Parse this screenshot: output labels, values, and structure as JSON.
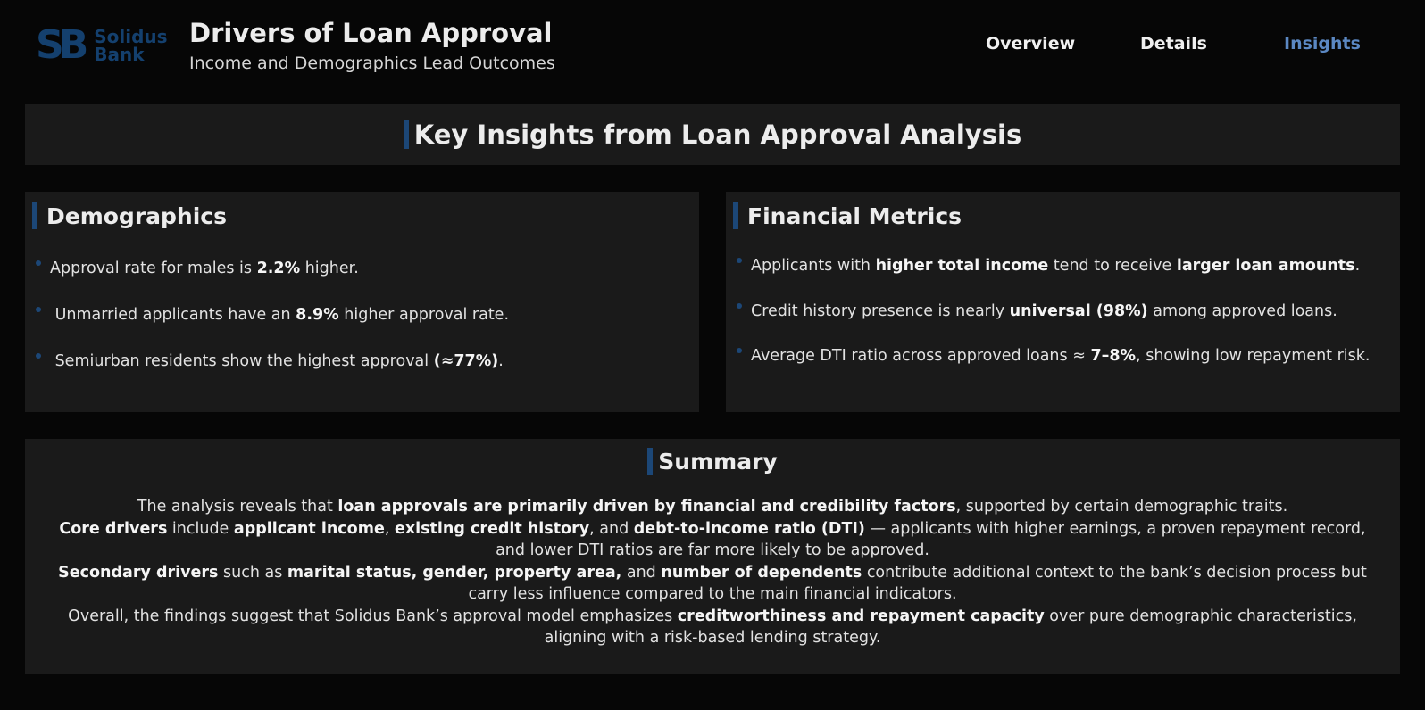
{
  "header": {
    "logo_mark": "SB",
    "logo_line1": "Solidus",
    "logo_line2": "Bank",
    "title": "Drivers of Loan Approval",
    "subtitle": "Income and Demographics Lead Outcomes"
  },
  "nav": {
    "items": [
      {
        "label": "Overview",
        "active": false
      },
      {
        "label": "Details",
        "active": false
      },
      {
        "label": "Insights",
        "active": true
      }
    ]
  },
  "banner": {
    "title": "Key Insights from Loan Approval Analysis"
  },
  "demographics": {
    "title": "Demographics",
    "bullets": [
      {
        "pre": "Approval rate for males is ",
        "bold": "2.2%",
        "post": " higher."
      },
      {
        "pre": "Unmarried applicants have an ",
        "bold": "8.9%",
        "post": " higher approval rate."
      },
      {
        "pre": "Semiurban residents show the highest approval ",
        "bold": "(≈77%)",
        "post": "."
      }
    ]
  },
  "financial": {
    "title": "Financial Metrics",
    "bullets": [
      {
        "pre": "Applicants with ",
        "bold": "higher total income",
        "mid": " tend to receive ",
        "bold2": "larger loan amounts",
        "post": "."
      },
      {
        "pre": "Credit history presence is nearly ",
        "bold": "universal (98%)",
        "post": " among approved loans."
      },
      {
        "pre": "Average DTI ratio across approved loans ≈ ",
        "bold": "7–8%",
        "post": ", showing low repayment risk."
      }
    ]
  },
  "summary": {
    "title": "Summary",
    "p1": {
      "a": "The analysis reveals that ",
      "b": "loan approvals are primarily driven by financial and credibility factors",
      "c": ", supported by certain demographic traits."
    },
    "p2": {
      "a": "Core drivers",
      "b": " include ",
      "c": "applicant income",
      "d": ", ",
      "e": "existing credit history",
      "f": ", and ",
      "g": "debt-to-income ratio (DTI)",
      "h": " — applicants with higher earnings, a proven repayment record, and lower DTI ratios are far more likely to be approved."
    },
    "p3": {
      "a": "Secondary drivers",
      "b": " such as ",
      "c": "marital status, gender, property area,",
      "d": " and ",
      "e": "number of dependents",
      "f": " contribute additional context to the bank’s decision process but carry less influence compared to the main financial indicators."
    },
    "p4": {
      "a": "Overall, the findings suggest that Solidus Bank’s approval model emphasizes ",
      "b": "creditworthiness and repayment capacity",
      "c": " over pure demographic characteristics, aligning with a risk-based lending strategy."
    }
  },
  "colors": {
    "accent": "#1c4777",
    "nav_active": "#5b88c3",
    "panel": "#1a1a1a",
    "background": "#060606"
  }
}
